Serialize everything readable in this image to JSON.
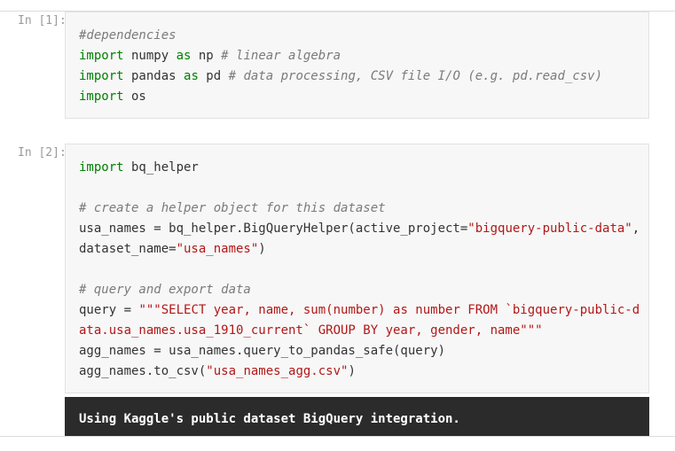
{
  "cells": [
    {
      "prompt": "In [1]:",
      "lines": [
        [
          {
            "t": "cm",
            "v": "#dependencies"
          }
        ],
        [
          {
            "t": "kw",
            "v": "import"
          },
          {
            "t": "",
            "v": " numpy "
          },
          {
            "t": "kw",
            "v": "as"
          },
          {
            "t": "",
            "v": " np "
          },
          {
            "t": "cm",
            "v": "# linear algebra"
          }
        ],
        [
          {
            "t": "kw",
            "v": "import"
          },
          {
            "t": "",
            "v": " pandas "
          },
          {
            "t": "kw",
            "v": "as"
          },
          {
            "t": "",
            "v": " pd "
          },
          {
            "t": "cm",
            "v": "# data processing, CSV file I/O (e.g. pd.read_csv)"
          }
        ],
        [
          {
            "t": "kw",
            "v": "import"
          },
          {
            "t": "",
            "v": " os"
          }
        ]
      ]
    },
    {
      "prompt": "In [2]:",
      "lines": [
        [
          {
            "t": "kw",
            "v": "import"
          },
          {
            "t": "",
            "v": " bq_helper"
          }
        ],
        [],
        [
          {
            "t": "cm",
            "v": "# create a helper object for this dataset"
          }
        ],
        [
          {
            "t": "",
            "v": "usa_names = bq_helper.BigQueryHelper(active_project="
          },
          {
            "t": "st",
            "v": "\"bigquery-public-data\""
          },
          {
            "t": "",
            "v": ","
          }
        ],
        [
          {
            "t": "",
            "v": "dataset_name="
          },
          {
            "t": "st",
            "v": "\"usa_names\""
          },
          {
            "t": "",
            "v": ")"
          }
        ],
        [],
        [
          {
            "t": "cm",
            "v": "# query and export data"
          }
        ],
        [
          {
            "t": "",
            "v": "query = "
          },
          {
            "t": "st",
            "v": "\"\"\"SELECT year, name, sum(number) as number FROM `bigquery-public-d"
          }
        ],
        [
          {
            "t": "st",
            "v": "ata.usa_names.usa_1910_current` GROUP BY year, gender, name\"\"\""
          }
        ],
        [
          {
            "t": "",
            "v": "agg_names = usa_names.query_to_pandas_safe(query)"
          }
        ],
        [
          {
            "t": "",
            "v": "agg_names.to_csv("
          },
          {
            "t": "st",
            "v": "\"usa_names_agg.csv\""
          },
          {
            "t": "",
            "v": ")"
          }
        ]
      ]
    }
  ],
  "output": {
    "text": "Using Kaggle's public dataset BigQuery integration."
  }
}
